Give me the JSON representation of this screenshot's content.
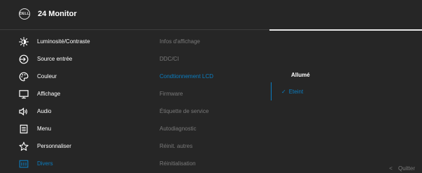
{
  "header": {
    "logo_text": "DELL",
    "title": "24 Monitor"
  },
  "menu": [
    {
      "label": "Luminosité/Contraste",
      "icon": "brightness-icon"
    },
    {
      "label": "Source entrée",
      "icon": "input-source-icon"
    },
    {
      "label": "Couleur",
      "icon": "color-palette-icon"
    },
    {
      "label": "Affichage",
      "icon": "display-icon"
    },
    {
      "label": "Audio",
      "icon": "speaker-icon"
    },
    {
      "label": "Menu",
      "icon": "menu-icon"
    },
    {
      "label": "Personnaliser",
      "icon": "star-icon"
    },
    {
      "label": "Divers",
      "icon": "info-icon"
    }
  ],
  "submenu": [
    {
      "label": "Infos d'affichage"
    },
    {
      "label": "DDC/CI"
    },
    {
      "label": "Condtionnement LCD"
    },
    {
      "label": "Firmware"
    },
    {
      "label": "Étiquette de service"
    },
    {
      "label": "Autodiagnostic"
    },
    {
      "label": "Réinit. autres"
    },
    {
      "label": "Réinitialisation"
    }
  ],
  "options": [
    {
      "label": "Allumé"
    },
    {
      "label": "Eteint",
      "check": "✓"
    }
  ],
  "footer": {
    "chevron": "<",
    "exit_label": "Quitter"
  },
  "colors": {
    "accent": "#0a7ec2",
    "background": "#262626",
    "text": "#ffffff",
    "muted": "#7a7a7a"
  }
}
